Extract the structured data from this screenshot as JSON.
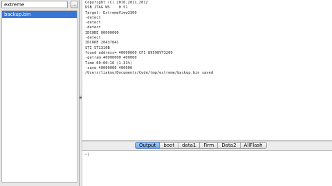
{
  "sidebar": {
    "path_value": "extreme",
    "browse_label": "...",
    "files": [
      {
        "label": "backup.bin"
      }
    ]
  },
  "output": {
    "lines": "Copyright (C) 2010,2011,2012\nUSB JTAG WS    0.51\nTarget: ExtremeView3300\n-detect\n-detect\n-detect\nIDCODE 00000000\n-detect\nIDCODE 20437041\nSTI ST1310B\nfound address= 40000000 CFI 89598VT3200\n-getram 40000000 400000\nTime 00:00:16 (1.31%)\n-save 40000000 400000\n/Users/liakno/Documents/Code/tmp/extreme/backup.bin saved"
  },
  "tabs": [
    {
      "label": "Output"
    },
    {
      "label": "boot"
    },
    {
      "label": "data1"
    },
    {
      "label": "Firm"
    },
    {
      "label": "Data2"
    },
    {
      "label": "AllFlash"
    }
  ],
  "input": {
    "prompt": "~❘"
  },
  "colors": {
    "selection": "#3875d7",
    "active_tab": "#6ea8ea"
  }
}
